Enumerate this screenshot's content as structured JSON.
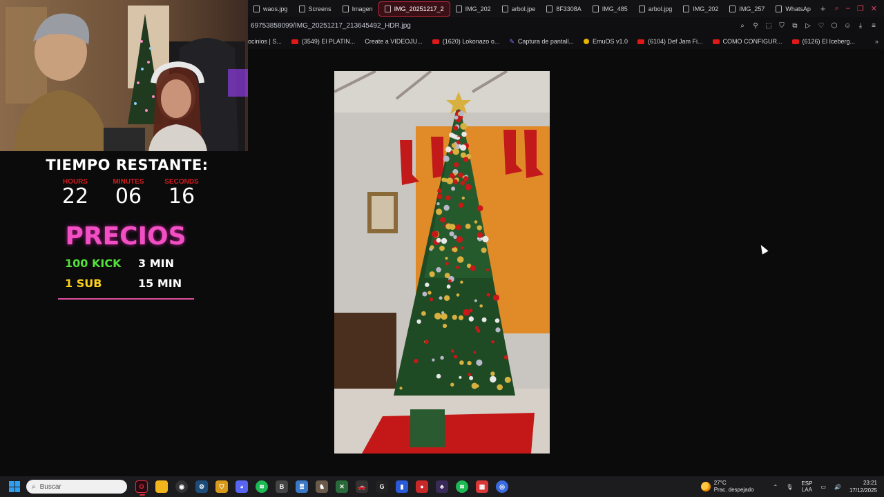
{
  "browser": {
    "tabs": [
      {
        "label": "waos.jpg",
        "active": false
      },
      {
        "label": "Screens",
        "active": false
      },
      {
        "label": "Imagen",
        "active": false
      },
      {
        "label": "IMG_20251217_2",
        "active": true
      },
      {
        "label": "IMG_202",
        "active": false
      },
      {
        "label": "arbol.jpe",
        "active": false
      },
      {
        "label": "8F3308A",
        "active": false
      },
      {
        "label": "IMG_485",
        "active": false
      },
      {
        "label": "arbol.jpg",
        "active": false
      },
      {
        "label": "IMG_202",
        "active": false
      },
      {
        "label": "IMG_257",
        "active": false
      },
      {
        "label": "WhatsAp",
        "active": false
      }
    ],
    "new_tab": "+",
    "address": "69753858099/IMG_20251217_213645492_HDR.jpg",
    "bookmarks": [
      {
        "label": "ocinios | S...",
        "icon": "none"
      },
      {
        "label": "(3549) El PLATIN...",
        "icon": "youtube-icon"
      },
      {
        "label": "Create a VIDEOJU...",
        "icon": "none"
      },
      {
        "label": "(1620) Lokonazo o...",
        "icon": "youtube-icon"
      },
      {
        "label": "Captura de pantall...",
        "icon": "feather-icon"
      },
      {
        "label": "EmuOS v1.0",
        "icon": "dot-icon"
      },
      {
        "label": "(6104) Def Jam Fi...",
        "icon": "youtube-icon"
      },
      {
        "label": "COMO CONFIGUR...",
        "icon": "youtube-icon"
      },
      {
        "label": "(6126) El Iceberg...",
        "icon": "youtube-icon"
      }
    ],
    "more": "»"
  },
  "overlay": {
    "countdown_title": "TIEMPO RESTANTE:",
    "hours_label": "HOURS",
    "minutes_label": "MINUTES",
    "seconds_label": "SECONDS",
    "hours": "22",
    "minutes": "06",
    "seconds": "16",
    "prices_title": "PRECIOS",
    "price1_amount": "100 KICK",
    "price1_time": "3 MIN",
    "price2_amount": "1 SUB",
    "price2_time": "15 MIN"
  },
  "taskbar": {
    "search_placeholder": "Buscar",
    "apps": [
      "opera-gx",
      "file-explorer",
      "obs",
      "steam",
      "shield",
      "discord",
      "spotify",
      "notes",
      "notepad",
      "game",
      "xbox",
      "car",
      "chrome-like",
      "bitwarden",
      "record",
      "app",
      "spotify-2",
      "calendar",
      "browser"
    ],
    "weather_temp": "27°C",
    "weather_desc": "Prac. despejado",
    "lang_1": "ESP",
    "lang_2": "LAA",
    "time": "23:21",
    "date": "17/12/2025"
  },
  "colors": {
    "accent": "#c8253a",
    "prices_pink": "#f24fc4",
    "kick_green": "#53e13a",
    "sub_yellow": "#ffd21a",
    "timer_label_red": "#d01c1c"
  }
}
